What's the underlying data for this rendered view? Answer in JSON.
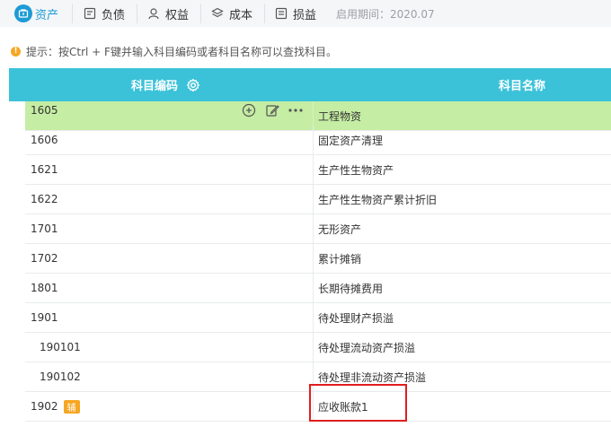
{
  "tabs": [
    {
      "label": "资产",
      "icon": "assets-icon",
      "active": true
    },
    {
      "label": "负债",
      "icon": "liabilities-icon",
      "active": false
    },
    {
      "label": "权益",
      "icon": "equity-icon",
      "active": false
    },
    {
      "label": "成本",
      "icon": "cost-icon",
      "active": false
    },
    {
      "label": "损益",
      "icon": "profit-loss-icon",
      "active": false
    }
  ],
  "period": "启用期间：2020.07",
  "hint": "提示：按Ctrl + F键并输入科目编码或者科目名称可以查找科目。",
  "table": {
    "header_code": "科目编码",
    "header_name": "科目名称",
    "aux_badge": "辅",
    "rows": [
      {
        "code": "1605",
        "name": "工程物资",
        "selected": true
      },
      {
        "code": "1606",
        "name": "固定资产清理"
      },
      {
        "code": "1621",
        "name": "生产性生物资产"
      },
      {
        "code": "1622",
        "name": "生产性生物资产累计折旧"
      },
      {
        "code": "1701",
        "name": "无形资产"
      },
      {
        "code": "1702",
        "name": "累计摊销"
      },
      {
        "code": "1801",
        "name": "长期待摊费用"
      },
      {
        "code": "1901",
        "name": "待处理财产损溢"
      },
      {
        "code": "190101",
        "name": "待处理流动资产损溢"
      },
      {
        "code": "190102",
        "name": "待处理非流动资产损溢"
      },
      {
        "code": "1902",
        "name": "应收账款1"
      }
    ]
  },
  "colors": {
    "accent": "#1d9bd6",
    "header_bg": "#3bc2d9",
    "selected_row": "#c5eda3",
    "badge": "#f5a623",
    "highlight": "#e11d1d"
  }
}
